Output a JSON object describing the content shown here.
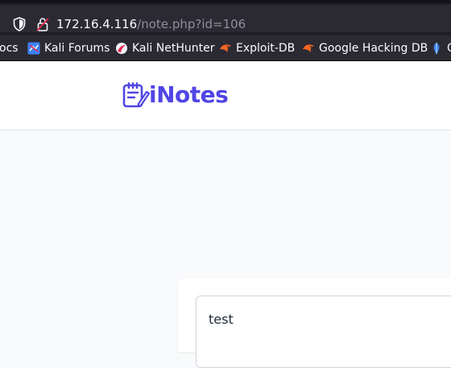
{
  "browser": {
    "url_host": "172.16.4.116",
    "url_path": "/note.php?id=106"
  },
  "bookmarks": [
    {
      "label": "ocs",
      "icon": "docs-icon"
    },
    {
      "label": "Kali Forums",
      "icon": "kali-forums-icon"
    },
    {
      "label": "Kali NetHunter",
      "icon": "kali-nethunter-icon"
    },
    {
      "label": "Exploit-DB",
      "icon": "exploit-db-icon"
    },
    {
      "label": "Google Hacking DB",
      "icon": "ghdb-icon"
    },
    {
      "label": "O",
      "icon": "offsec-icon"
    }
  ],
  "site": {
    "logo_text": "iNotes",
    "brand_color": "#5046e5"
  },
  "note": {
    "title_value": "test"
  }
}
